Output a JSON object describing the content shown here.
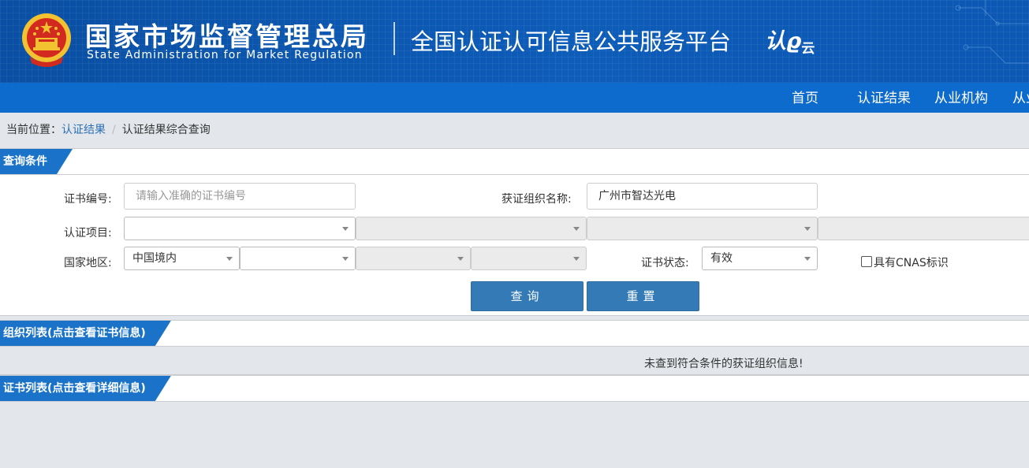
{
  "header": {
    "org_name_cn": "国家市场监督管理总局",
    "org_name_en": "State Administration  for  Market Regulation",
    "platform_title": "全国认证认可信息公共服务平台",
    "logo_text": "认",
    "logo_text_2": "云"
  },
  "nav": {
    "items": [
      {
        "label": "首页"
      },
      {
        "label": "认证结果"
      },
      {
        "label": "从业机构"
      },
      {
        "label": "从业"
      }
    ]
  },
  "breadcrumb": {
    "prefix": "当前位置：",
    "link": "认证结果",
    "separator": "/",
    "current": "认证结果综合查询"
  },
  "query_section": {
    "title": "查询条件",
    "cert_no_label": "证书编号:",
    "cert_no_placeholder": "请输入准确的证书编号",
    "org_name_label": "获证组织名称:",
    "org_name_value": "广州市智达光电",
    "project_label": "认证项目:",
    "region_label": "国家地区:",
    "region_value": "中国境内",
    "status_label": "证书状态:",
    "status_value": "有效",
    "cnas_label": "具有CNAS标识",
    "cnas_checked": false,
    "search_button": "查询",
    "reset_button": "重置"
  },
  "org_list": {
    "title": "组织列表(点击查看证书信息)",
    "empty_message": "未查到符合条件的获证组织信息!"
  },
  "cert_list": {
    "title": "证书列表(点击查看详细信息)"
  },
  "colors": {
    "banner": "#0d5cb8",
    "nav": "#0e6bce",
    "section_tab": "#1a73c9",
    "button": "#337ab7",
    "link": "#2d6fb5"
  }
}
